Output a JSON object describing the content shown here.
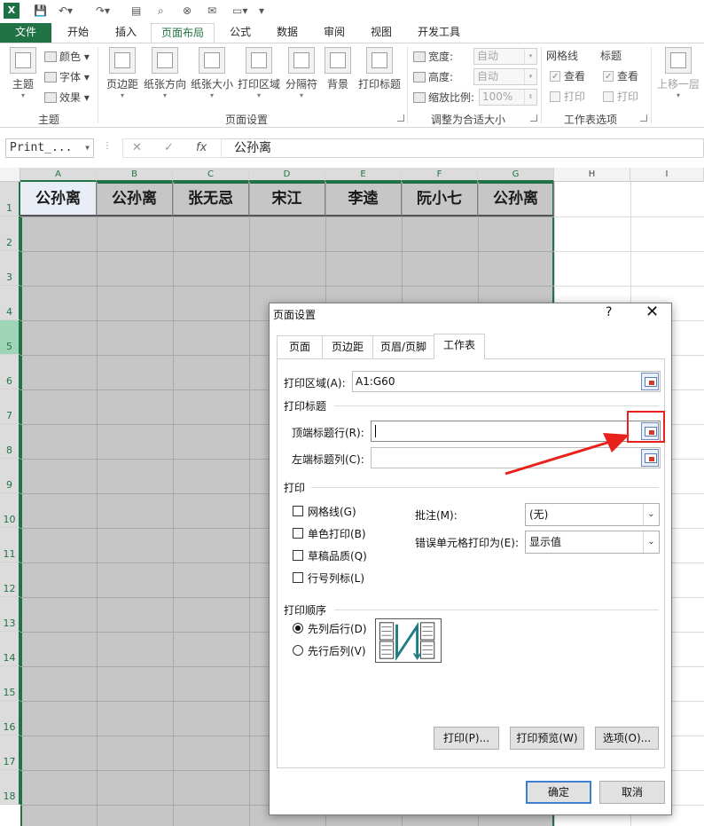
{
  "app": {
    "logo_letter": "X"
  },
  "tabs": [
    {
      "label": "文件"
    },
    {
      "label": "开始"
    },
    {
      "label": "插入"
    },
    {
      "label": "页面布局"
    },
    {
      "label": "公式"
    },
    {
      "label": "数据"
    },
    {
      "label": "审阅"
    },
    {
      "label": "视图"
    },
    {
      "label": "开发工具"
    }
  ],
  "ribbon": {
    "theme": {
      "big": "主题",
      "colors": "颜色",
      "fonts": "字体",
      "effects": "效果",
      "group": "主题"
    },
    "page_setup": {
      "buttons": [
        "页边距",
        "纸张方向",
        "纸张大小",
        "打印区域",
        "分隔符",
        "背景",
        "打印标题"
      ],
      "group": "页面设置"
    },
    "scale": {
      "width_label": "宽度:",
      "width_value": "自动",
      "height_label": "高度:",
      "height_value": "自动",
      "zoom_label": "缩放比例:",
      "zoom_value": "100%",
      "group": "调整为合适大小"
    },
    "sheet_options": {
      "gridlines": "网格线",
      "headings": "标题",
      "view": "查看",
      "print": "打印",
      "group": "工作表选项"
    },
    "arrange": {
      "bring_forward": "上移一层"
    }
  },
  "formula_bar": {
    "name_box": "Print_...",
    "content": "公孙离"
  },
  "grid": {
    "columns": [
      "A",
      "B",
      "C",
      "D",
      "E",
      "F",
      "G",
      "H",
      "I"
    ],
    "rows": [
      "1",
      "2",
      "3",
      "4",
      "5",
      "6",
      "7",
      "8",
      "9",
      "10",
      "11",
      "12",
      "13",
      "14",
      "15",
      "16",
      "17",
      "18"
    ],
    "header_cells": [
      "公孙离",
      "公孙离",
      "张无忌",
      "宋江",
      "李逵",
      "阮小七",
      "公孙离"
    ]
  },
  "dialog": {
    "title": "页面设置",
    "help": "?",
    "close": "✕",
    "tabs": [
      {
        "label": "页面"
      },
      {
        "label": "页边距"
      },
      {
        "label": "页眉/页脚"
      },
      {
        "label": "工作表"
      }
    ],
    "print_area_label": "打印区域(A):",
    "print_area_value": "A1:G60",
    "print_titles_section": "打印标题",
    "rows_to_repeat_label": "顶端标题行(R):",
    "rows_to_repeat_value": "",
    "cols_to_repeat_label": "左端标题列(C):",
    "cols_to_repeat_value": "",
    "print_section": "打印",
    "gridlines": "网格线(G)",
    "black_white": "单色打印(B)",
    "draft_quality": "草稿品质(Q)",
    "row_col_headings": "行号列标(L)",
    "comments_label": "批注(M):",
    "comments_value": "(无)",
    "errors_label": "错误单元格打印为(E):",
    "errors_value": "显示值",
    "page_order_section": "打印顺序",
    "down_then_over": "先列后行(D)",
    "over_then_down": "先行后列(V)",
    "btn_print": "打印(P)...",
    "btn_preview": "打印预览(W)",
    "btn_options": "选项(O)...",
    "btn_ok": "确定",
    "btn_cancel": "取消"
  },
  "colors": {
    "excel_green": "#217346",
    "highlight_red": "#e8221b",
    "selection_gray": "#c6c6c6"
  }
}
